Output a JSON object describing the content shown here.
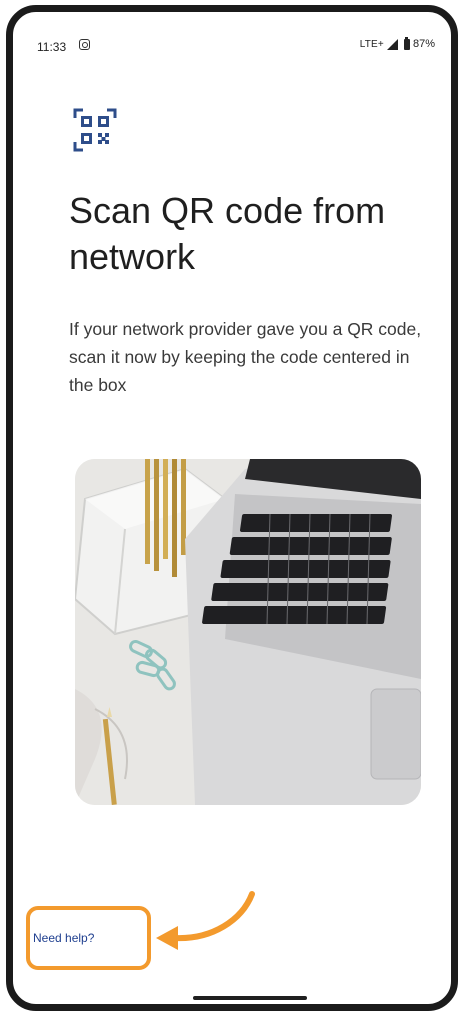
{
  "status_bar": {
    "time": "11:33",
    "network": "LTE+",
    "battery": "87%"
  },
  "title": "Scan QR code from network",
  "description": "If your network provider gave you a QR code, scan it now by keeping the code centered in the box",
  "help_link": "Need help?",
  "colors": {
    "accent": "#1f3f8f",
    "qr_icon": "#2e4d8a",
    "highlight": "#f39a2d"
  },
  "icons": {
    "header": "qr-code-scan-icon",
    "status_notification": "camera-icon",
    "signal": "signal-icon",
    "battery": "battery-icon"
  }
}
